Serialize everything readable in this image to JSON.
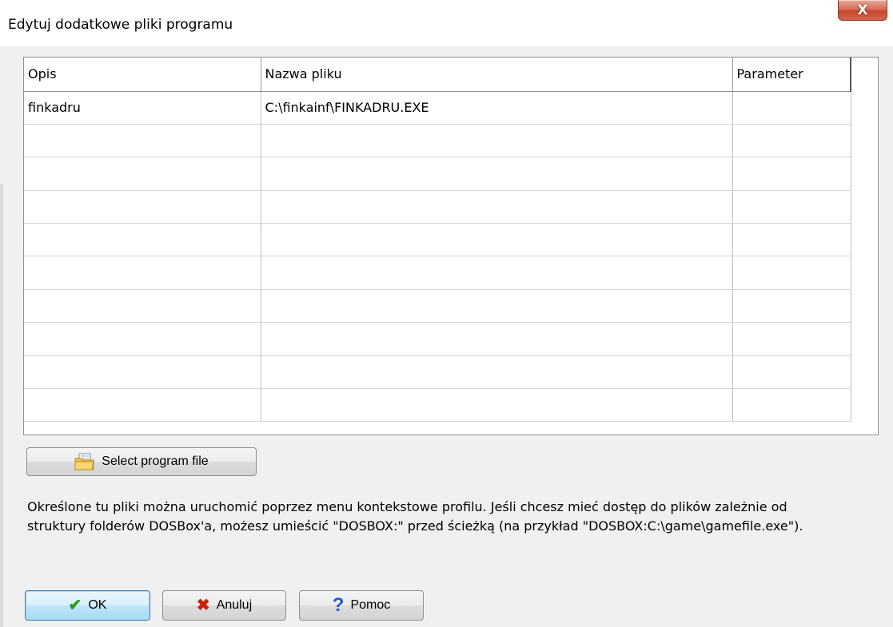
{
  "window": {
    "title": "Edytuj dodatkowe pliki programu",
    "close_icon": "close-icon",
    "close_glyph": "X"
  },
  "grid": {
    "columns": [
      "Opis",
      "Nazwa pliku",
      "Parameter"
    ],
    "rows": [
      [
        "finkadru",
        "C:\\finkainf\\FINKADRU.EXE",
        ""
      ],
      [
        "",
        "",
        ""
      ],
      [
        "",
        "",
        ""
      ],
      [
        "",
        "",
        ""
      ],
      [
        "",
        "",
        ""
      ],
      [
        "",
        "",
        ""
      ],
      [
        "",
        "",
        ""
      ],
      [
        "",
        "",
        ""
      ],
      [
        "",
        "",
        ""
      ],
      [
        "",
        "",
        ""
      ]
    ]
  },
  "select_button": {
    "label": "Select program file",
    "icon": "folder-icon"
  },
  "info": {
    "line1": "Określone tu pliki można uruchomić poprzez menu kontekstowe profilu. Jeśli chcesz mieć dostęp do plików zależnie od",
    "line2": "struktury folderów DOSBox'a, możesz umieścić \"DOSBOX:\" przed ścieżką (na przykład \"DOSBOX:C:\\game\\gamefile.exe\")."
  },
  "buttons": {
    "ok": {
      "label": "OK",
      "icon": "check-icon",
      "glyph": "✔"
    },
    "cancel": {
      "label": "Anuluj",
      "icon": "cross-icon",
      "glyph": "✖"
    },
    "help": {
      "label": "Pomoc",
      "icon": "question-icon",
      "glyph": "?"
    }
  },
  "colors": {
    "close_button": "#c8462c",
    "ok_check": "#2a9a1a",
    "cancel_cross": "#c8200a",
    "help_question": "#1e5bd8",
    "default_button_border": "#3c7fb1"
  }
}
